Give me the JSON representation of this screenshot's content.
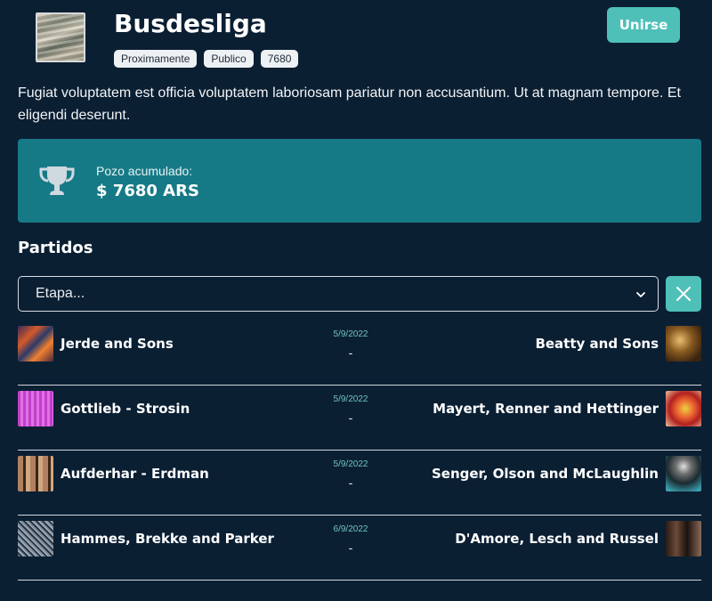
{
  "league": {
    "title": "Busdesliga",
    "badges": [
      "Proximamente",
      "Publico",
      "7680"
    ],
    "join_label": "Unirse",
    "description": "Fugiat voluptatem est officia voluptatem laboriosam pariatur non accusantium. Ut at magnam tempore. Et eligendi deserunt."
  },
  "jackpot": {
    "label": "Pozo acumulado:",
    "amount": "$ 7680 ARS",
    "icon": "trophy-icon"
  },
  "matches_section": {
    "title": "Partidos",
    "stage_placeholder": "Etapa...",
    "clear_icon": "close-icon"
  },
  "matches": [
    {
      "home": "Jerde and Sons",
      "away": "Beatty and Sons",
      "date": "5/9/2022",
      "score": "-"
    },
    {
      "home": "Gottlieb - Strosin",
      "away": "Mayert, Renner and Hettinger",
      "date": "5/9/2022",
      "score": "-"
    },
    {
      "home": "Aufderhar - Erdman",
      "away": "Senger, Olson and McLaughlin",
      "date": "5/9/2022",
      "score": "-"
    },
    {
      "home": "Hammes, Brekke and Parker",
      "away": "D'Amore, Lesch and Russel",
      "date": "6/9/2022",
      "score": "-"
    }
  ],
  "colors": {
    "background": "#0b1f33",
    "accent": "#4fc0b8",
    "jackpot_bg": "#167a86"
  }
}
